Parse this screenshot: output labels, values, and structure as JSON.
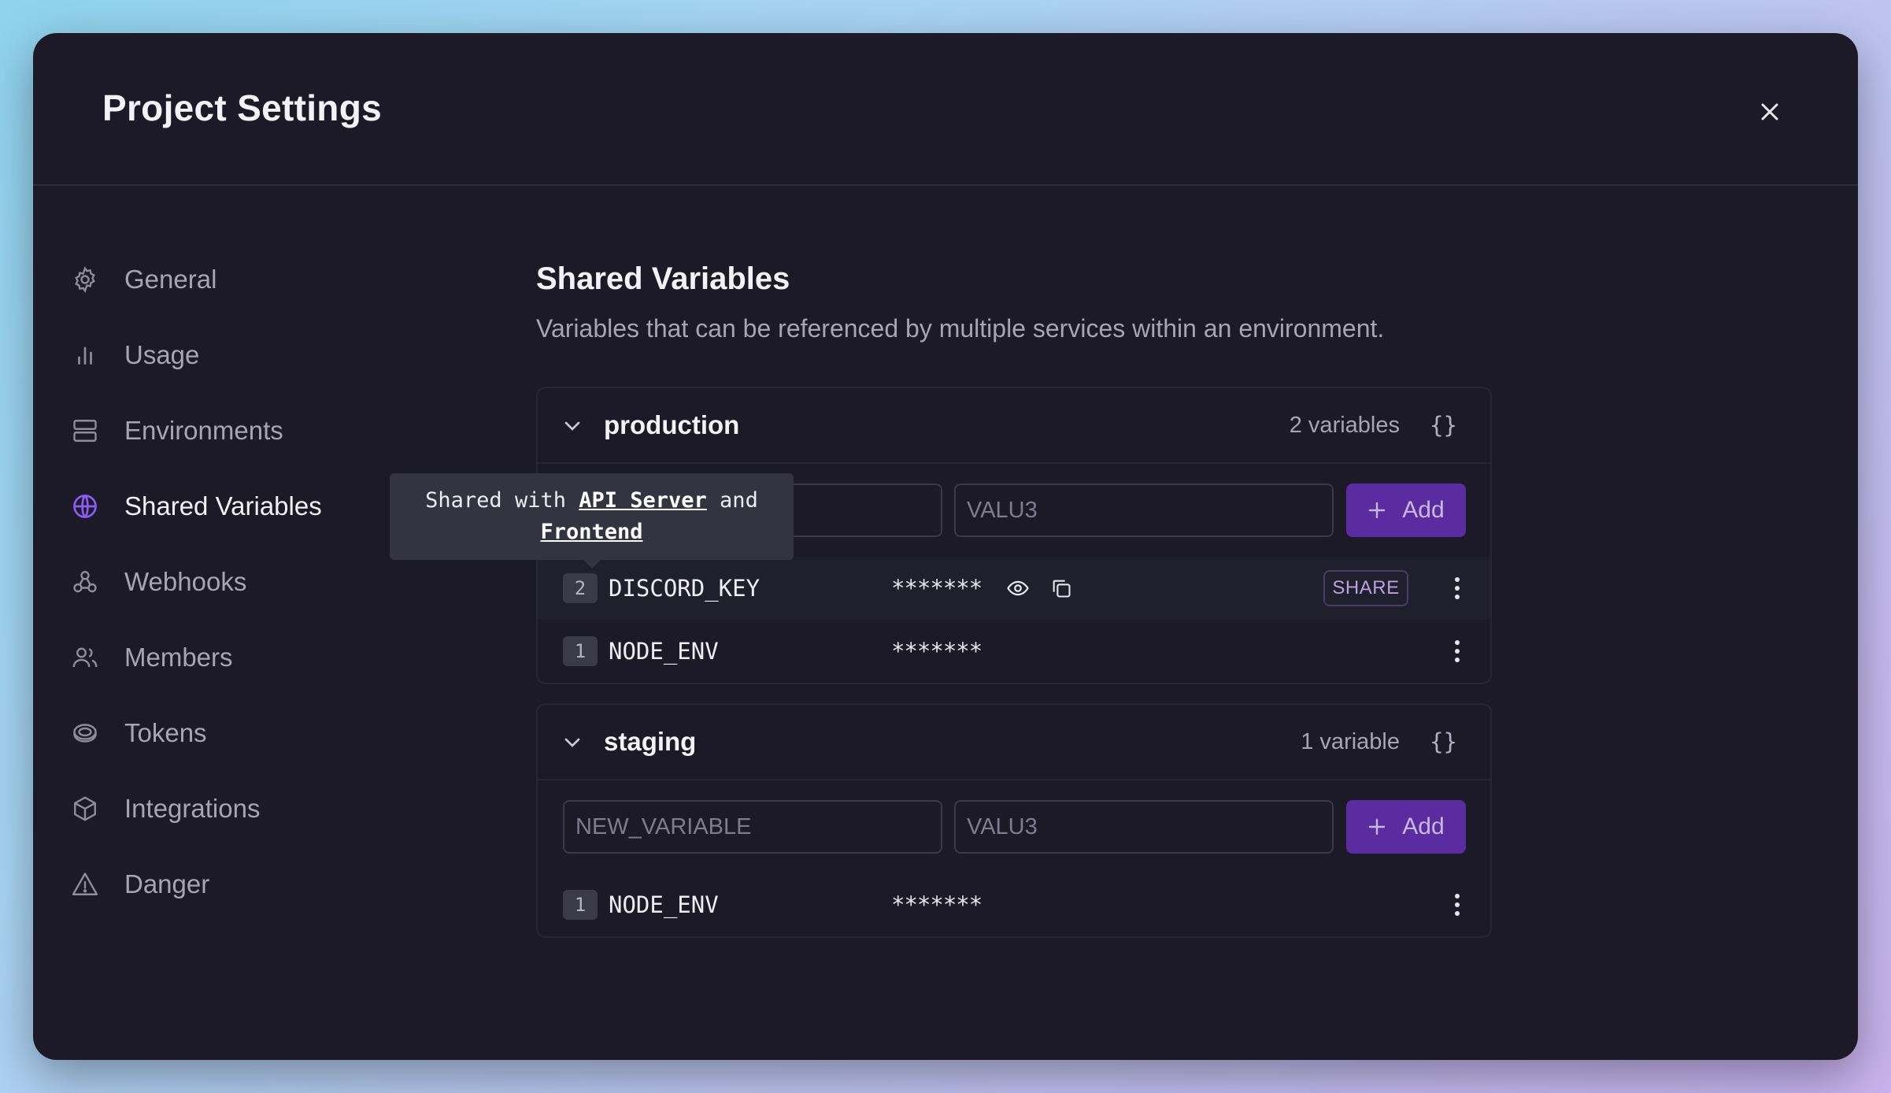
{
  "modal": {
    "title": "Project Settings"
  },
  "sidebar": {
    "items": [
      {
        "label": "General",
        "icon": "gear-icon"
      },
      {
        "label": "Usage",
        "icon": "bar-chart-icon"
      },
      {
        "label": "Environments",
        "icon": "server-icon"
      },
      {
        "label": "Shared Variables",
        "icon": "globe-icon",
        "active": true
      },
      {
        "label": "Webhooks",
        "icon": "webhook-icon"
      },
      {
        "label": "Members",
        "icon": "users-icon"
      },
      {
        "label": "Tokens",
        "icon": "coin-icon"
      },
      {
        "label": "Integrations",
        "icon": "cube-icon"
      },
      {
        "label": "Danger",
        "icon": "warning-icon"
      }
    ]
  },
  "main": {
    "title": "Shared Variables",
    "description": "Variables that can be referenced by multiple services within an environment."
  },
  "tooltip": {
    "prefix": "Shared with ",
    "service1": "API Server",
    "middle": " and",
    "service2": "Frontend"
  },
  "environments": [
    {
      "name": "production",
      "count": "2 variables",
      "braces": "{}",
      "name_placeholder": "NEW_VARIABLE",
      "value_placeholder": "VALU3",
      "add_label": "Add",
      "variables": [
        {
          "badge": "2",
          "name": "DISCORD_KEY",
          "value": "*******",
          "share_label": "SHARE"
        },
        {
          "badge": "1",
          "name": "NODE_ENV",
          "value": "*******"
        }
      ]
    },
    {
      "name": "staging",
      "count": "1 variable",
      "braces": "{}",
      "name_placeholder": "NEW_VARIABLE",
      "value_placeholder": "VALU3",
      "add_label": "Add",
      "variables": [
        {
          "badge": "1",
          "name": "NODE_ENV",
          "value": "*******"
        }
      ]
    }
  ],
  "colors": {
    "accent": "#5b2ca0",
    "active_icon": "#8b5cf6",
    "background": "#1b1a26"
  }
}
